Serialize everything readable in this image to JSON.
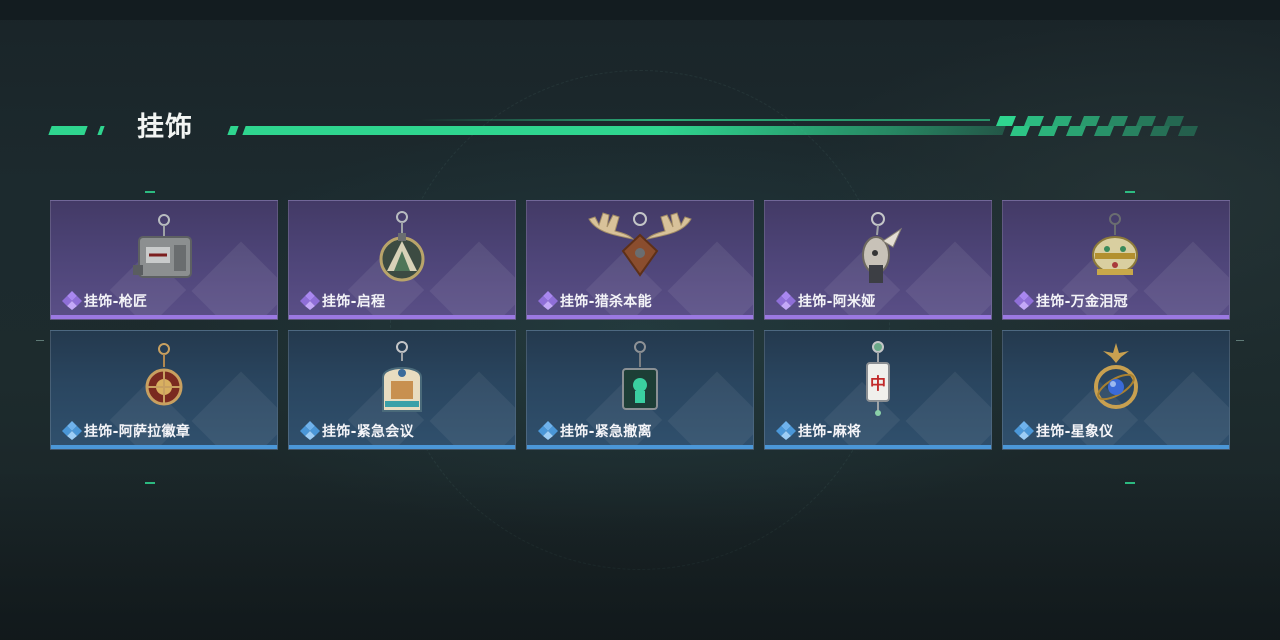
{
  "section": {
    "title": "挂饰"
  },
  "colors": {
    "accent": "#2fd58f",
    "epic": "#9b79e2",
    "rare": "#4b97d8"
  },
  "items": [
    {
      "label": "挂饰-枪匠",
      "rarity": "epic",
      "icon": "gun-crate-charm-icon"
    },
    {
      "label": "挂饰-启程",
      "rarity": "epic",
      "icon": "mountain-medallion-charm-icon"
    },
    {
      "label": "挂饰-猎杀本能",
      "rarity": "epic",
      "icon": "moose-antler-charm-icon"
    },
    {
      "label": "挂饰-阿米娅",
      "rarity": "epic",
      "icon": "bunny-figure-charm-icon"
    },
    {
      "label": "挂饰-万金泪冠",
      "rarity": "epic",
      "icon": "jeweled-crown-charm-icon"
    },
    {
      "label": "挂饰-阿萨拉徽章",
      "rarity": "rare",
      "icon": "badge-medal-charm-icon"
    },
    {
      "label": "挂饰-紧急会议",
      "rarity": "rare",
      "icon": "arch-emblem-charm-icon"
    },
    {
      "label": "挂饰-紧急撤离",
      "rarity": "rare",
      "icon": "green-sign-charm-icon"
    },
    {
      "label": "挂饰-麻将",
      "rarity": "rare",
      "icon": "mahjong-tile-charm-icon"
    },
    {
      "label": "挂饰-星象仪",
      "rarity": "rare",
      "icon": "armillary-sphere-charm-icon"
    }
  ]
}
